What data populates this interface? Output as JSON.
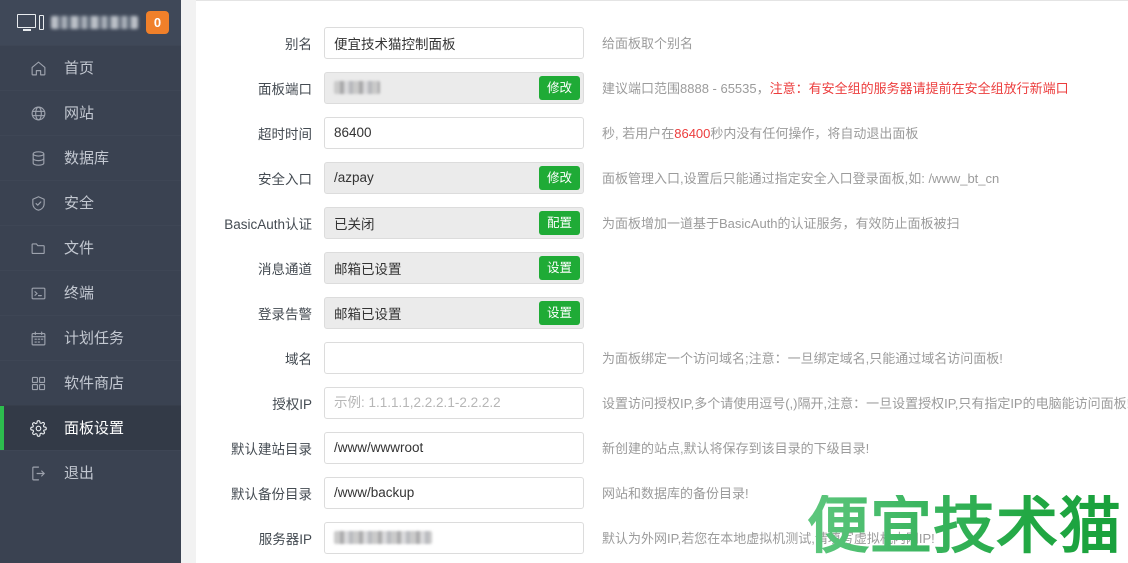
{
  "sidebar": {
    "header": {
      "monitor_icon": "monitor-icon",
      "server_name_redacted": "",
      "badge_count": "0"
    },
    "items": [
      {
        "icon": "home-icon",
        "label": "首页",
        "active": false
      },
      {
        "icon": "globe-icon",
        "label": "网站",
        "active": false
      },
      {
        "icon": "database-icon",
        "label": "数据库",
        "active": false
      },
      {
        "icon": "shield-icon",
        "label": "安全",
        "active": false
      },
      {
        "icon": "folder-icon",
        "label": "文件",
        "active": false
      },
      {
        "icon": "terminal-icon",
        "label": "终端",
        "active": false
      },
      {
        "icon": "calendar-icon",
        "label": "计划任务",
        "active": false
      },
      {
        "icon": "grid-icon",
        "label": "软件商店",
        "active": false
      },
      {
        "icon": "gear-icon",
        "label": "面板设置",
        "active": true
      },
      {
        "icon": "logout-icon",
        "label": "退出",
        "active": false
      }
    ]
  },
  "form": {
    "rows": [
      {
        "label": "别名",
        "value": "便宜技术猫控制面板",
        "placeholder": "",
        "readonly": false,
        "blurred": false,
        "button": "",
        "help": "给面板取个别名",
        "help_red": "",
        "help_tail": ""
      },
      {
        "label": "面板端口",
        "value": "",
        "placeholder": "",
        "readonly": true,
        "blurred": true,
        "button": "修改",
        "help": "建议端口范围8888 - 65535，",
        "help_red": "注意：有安全组的服务器请提前在安全组放行新端口",
        "help_tail": ""
      },
      {
        "label": "超时时间",
        "value": "86400",
        "placeholder": "",
        "readonly": false,
        "blurred": false,
        "button": "",
        "help": "秒, 若用户在",
        "help_red": "86400",
        "help_tail": "秒内没有任何操作，将自动退出面板"
      },
      {
        "label": "安全入口",
        "value": "/azpay",
        "placeholder": "",
        "readonly": true,
        "blurred": false,
        "button": "修改",
        "help": "面板管理入口,设置后只能通过指定安全入口登录面板,如: /www_bt_cn",
        "help_red": "",
        "help_tail": ""
      },
      {
        "label": "BasicAuth认证",
        "value": "已关闭",
        "placeholder": "",
        "readonly": true,
        "blurred": false,
        "button": "配置",
        "help": "为面板增加一道基于BasicAuth的认证服务，有效防止面板被扫",
        "help_red": "",
        "help_tail": ""
      },
      {
        "label": "消息通道",
        "value": "邮箱已设置",
        "placeholder": "",
        "readonly": true,
        "blurred": false,
        "button": "设置",
        "help": "",
        "help_red": "",
        "help_tail": ""
      },
      {
        "label": "登录告警",
        "value": "邮箱已设置",
        "placeholder": "",
        "readonly": true,
        "blurred": false,
        "button": "设置",
        "help": "",
        "help_red": "",
        "help_tail": ""
      },
      {
        "label": "域名",
        "value": "",
        "placeholder": "",
        "readonly": false,
        "blurred": false,
        "button": "",
        "help": "为面板绑定一个访问域名;注意：一旦绑定域名,只能通过域名访问面板!",
        "help_red": "",
        "help_tail": ""
      },
      {
        "label": "授权IP",
        "value": "",
        "placeholder": "示例: 1.1.1.1,2.2.2.1-2.2.2.2",
        "readonly": false,
        "blurred": false,
        "button": "",
        "help": "设置访问授权IP,多个请使用逗号(,)隔开,注意：一旦设置授权IP,只有指定IP的电脑能访问面板!",
        "help_red": "",
        "help_tail": ""
      },
      {
        "label": "默认建站目录",
        "value": "/www/wwwroot",
        "placeholder": "",
        "readonly": false,
        "blurred": false,
        "button": "",
        "help": "新创建的站点,默认将保存到该目录的下级目录!",
        "help_red": "",
        "help_tail": ""
      },
      {
        "label": "默认备份目录",
        "value": "/www/backup",
        "placeholder": "",
        "readonly": false,
        "blurred": false,
        "button": "",
        "help": "网站和数据库的备份目录!",
        "help_red": "",
        "help_tail": ""
      },
      {
        "label": "服务器IP",
        "value": "",
        "placeholder": "",
        "readonly": false,
        "blurred": true,
        "button": "",
        "help": "默认为外网IP,若您在本地虚拟机测试,请填写虚拟机内网IP!",
        "help_red": "",
        "help_tail": ""
      }
    ]
  },
  "watermark": {
    "text": "便宜技术猫"
  },
  "colors": {
    "sidebar_bg": "#3a4251",
    "sidebar_active_bg": "#333a47",
    "accent_green": "#1fab36",
    "active_bar_green": "#2dbd4e",
    "badge_orange": "#f0802a",
    "help_text": "#9b9b9b",
    "warn_red": "#ec3d3d",
    "watermark_green": "#2faf4e"
  }
}
